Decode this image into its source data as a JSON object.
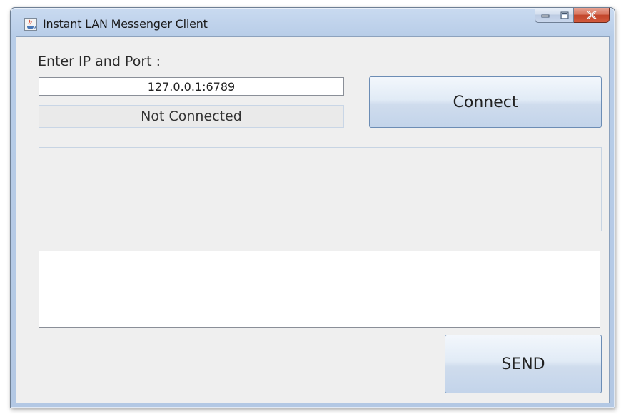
{
  "window": {
    "title": "Instant LAN Messenger Client",
    "app_icon": "java-cup-icon",
    "controls": {
      "minimize_icon": "minimize-icon",
      "maximize_icon": "maximize-icon",
      "close_icon": "close-icon"
    },
    "accent_close": "#c8472c",
    "frame_color": "#b8cde8"
  },
  "connection": {
    "ip_label": "Enter IP and Port :",
    "ip_value": "127.0.0.1:6789",
    "status": "Not Connected",
    "connect_label": "Connect"
  },
  "chat": {
    "history": "",
    "message_value": "",
    "send_label": "SEND"
  }
}
